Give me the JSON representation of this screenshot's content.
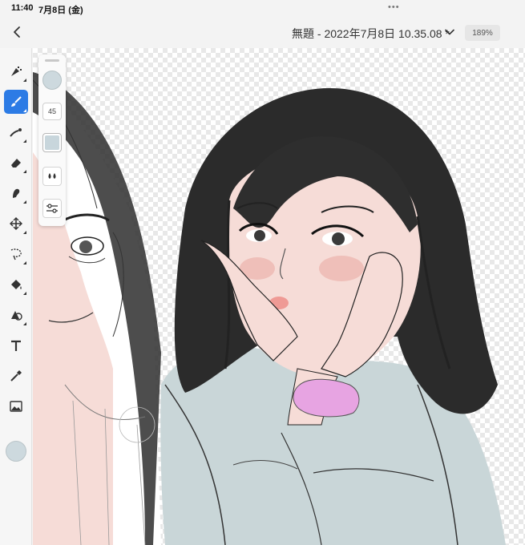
{
  "status_bar": {
    "time": "11:40",
    "date": "7月8日 (金)",
    "dots": "•••"
  },
  "top_bar": {
    "title": "無題 - 2022年7月8日 10.35.08 *",
    "zoom": "189%"
  },
  "tools": [
    {
      "name": "pixel-brush"
    },
    {
      "name": "live-brush",
      "active": true
    },
    {
      "name": "vector-brush"
    },
    {
      "name": "eraser"
    },
    {
      "name": "smudge"
    },
    {
      "name": "transform"
    },
    {
      "name": "selection"
    },
    {
      "name": "fill"
    },
    {
      "name": "shape"
    },
    {
      "name": "text"
    },
    {
      "name": "eyedropper"
    },
    {
      "name": "image"
    }
  ],
  "brush_panel": {
    "size": "45"
  },
  "colors": {
    "accent": "#2c7be5",
    "current_color": "#cdd9de",
    "skin": "#f6dcd7",
    "jacket": "#c9d6d8",
    "scrunchie": "#e7a4e2",
    "hair": "#2a2a2a"
  }
}
